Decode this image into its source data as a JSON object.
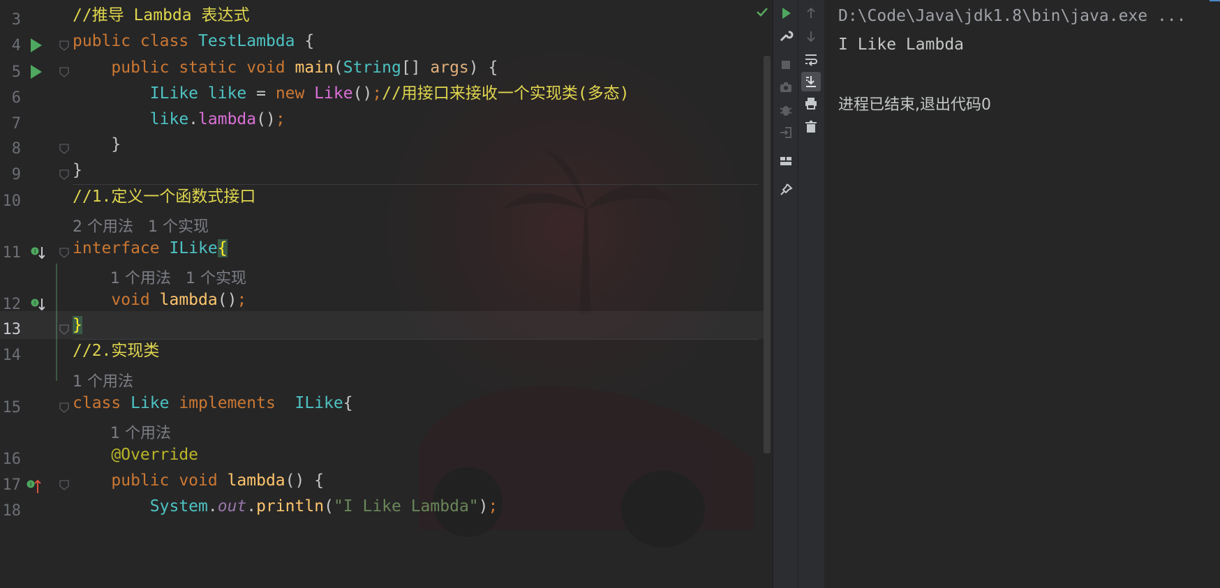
{
  "editor": {
    "lines": [
      {
        "no": "3",
        "tokens": [
          [
            "cmt",
            "//推导 Lambda 表达式"
          ]
        ]
      },
      {
        "no": "4",
        "tokens": [
          [
            "kw",
            "public class "
          ],
          [
            "cls",
            "TestLambda "
          ],
          [
            "pl",
            "{"
          ]
        ]
      },
      {
        "no": "5",
        "tokens": [
          [
            "pl",
            "    "
          ],
          [
            "kw",
            "public static void "
          ],
          [
            "fn",
            "main"
          ],
          [
            "pl",
            "("
          ],
          [
            "cls",
            "String"
          ],
          [
            "pl",
            "[] "
          ],
          [
            "pm",
            "args"
          ],
          [
            "pl",
            ") {"
          ]
        ]
      },
      {
        "no": "6",
        "tokens": [
          [
            "pl",
            "        "
          ],
          [
            "cls",
            "ILike "
          ],
          [
            "vr",
            "like"
          ],
          [
            "pl",
            " = "
          ],
          [
            "kw",
            "new "
          ],
          [
            "ob",
            "Like"
          ],
          [
            "pl",
            "()"
          ],
          [
            "kw",
            ";"
          ],
          [
            "cmt",
            "//用接口来接收一个实现类(多态)"
          ]
        ]
      },
      {
        "no": "7",
        "tokens": [
          [
            "pl",
            "        "
          ],
          [
            "vr",
            "like"
          ],
          [
            "pl",
            "."
          ],
          [
            "ob",
            "lambda"
          ],
          [
            "pl",
            "()"
          ],
          [
            "kw",
            ";"
          ]
        ]
      },
      {
        "no": "8",
        "tokens": [
          [
            "pl",
            "    }"
          ]
        ]
      },
      {
        "no": "9",
        "tokens": [
          [
            "pl",
            "}"
          ]
        ]
      },
      {
        "no": "10",
        "tokens": [
          [
            "cmt",
            "//1.定义一个函数式接口"
          ]
        ]
      },
      {
        "hint": "2 个用法   1 个实现",
        "indent": 0
      },
      {
        "no": "11",
        "tokens": [
          [
            "kw",
            "interface "
          ],
          [
            "cls",
            "ILike"
          ],
          [
            "bm",
            "{"
          ]
        ]
      },
      {
        "hint": "1 个用法   1 个实现",
        "indent": 1
      },
      {
        "no": "12",
        "tokens": [
          [
            "pl",
            "    "
          ],
          [
            "kw",
            "void "
          ],
          [
            "fn",
            "lambda"
          ],
          [
            "pl",
            "()"
          ],
          [
            "kw",
            ";"
          ]
        ]
      },
      {
        "no": "13",
        "tokens": [
          [
            "bm",
            "}"
          ]
        ],
        "current": true
      },
      {
        "no": "14",
        "tokens": [
          [
            "cmt",
            "//2.实现类"
          ]
        ]
      },
      {
        "hint": "1 个用法",
        "indent": 0
      },
      {
        "no": "15",
        "tokens": [
          [
            "kw",
            "class "
          ],
          [
            "cls",
            "Like "
          ],
          [
            "kw",
            "implements  "
          ],
          [
            "cls",
            "ILike"
          ],
          [
            "pl",
            "{"
          ]
        ]
      },
      {
        "hint": "1 个用法",
        "indent": 1
      },
      {
        "no": "16",
        "tokens": [
          [
            "pl",
            "    "
          ],
          [
            "an",
            "@Override"
          ]
        ]
      },
      {
        "no": "17",
        "tokens": [
          [
            "pl",
            "    "
          ],
          [
            "kw",
            "public void "
          ],
          [
            "fn",
            "lambda"
          ],
          [
            "pl",
            "() {"
          ]
        ]
      },
      {
        "no": "18",
        "tokens": [
          [
            "pl",
            "        "
          ],
          [
            "cls",
            "System"
          ],
          [
            "pl",
            "."
          ],
          [
            "stat",
            "out"
          ],
          [
            "pl",
            "."
          ],
          [
            "fn",
            "println"
          ],
          [
            "pl",
            "("
          ],
          [
            "st",
            "\"I Like Lambda\""
          ],
          [
            "pl",
            ")"
          ],
          [
            "kw",
            ";"
          ]
        ]
      }
    ]
  },
  "console": {
    "command": "D:\\Code\\Java\\jdk1.8\\bin\\java.exe ...",
    "output": "I Like Lambda",
    "exit_message": "进程已结束,退出代码0"
  },
  "toolbar": {
    "left": [
      "run-icon",
      "wrench-icon",
      "stop-icon",
      "camera-icon",
      "debug-icon",
      "login-icon",
      "layout-icon",
      "pin-icon"
    ],
    "right": [
      "arrow-up-icon",
      "arrow-down-icon",
      "soft-wrap-icon",
      "scroll-to-end-icon",
      "print-icon",
      "trash-icon"
    ]
  },
  "colors": {
    "keyword": "#cc7832",
    "class": "#4ec3c3",
    "method": "#ffc66d",
    "comment": "#e0d64e",
    "string": "#6a8759",
    "annotation": "#bbb529",
    "background": "#262627",
    "run_green": "#4fa85f"
  }
}
